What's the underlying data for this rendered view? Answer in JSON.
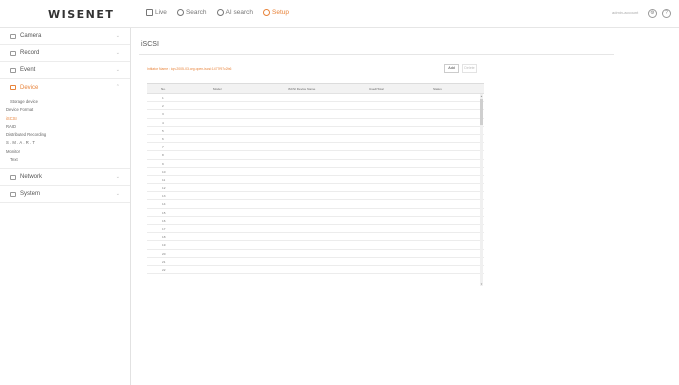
{
  "app": {
    "logo": "WISENET"
  },
  "top_nav": [
    {
      "label": "Live",
      "icon": "monitor-icon",
      "active": false
    },
    {
      "label": "Search",
      "icon": "search-icon",
      "active": false
    },
    {
      "label": "AI search",
      "icon": "ai-search-icon",
      "active": false
    },
    {
      "label": "Setup",
      "icon": "gear-icon",
      "active": true
    }
  ],
  "user": {
    "name": "admin-account"
  },
  "sidebar": {
    "menus": [
      {
        "label": "Camera",
        "icon": "camera-icon"
      },
      {
        "label": "Record",
        "icon": "record-icon"
      },
      {
        "label": "Event",
        "icon": "bell-icon"
      },
      {
        "label": "Device",
        "icon": "device-icon",
        "active": true
      },
      {
        "label": "Network",
        "icon": "network-icon"
      },
      {
        "label": "System",
        "icon": "system-icon"
      }
    ],
    "device_items": [
      {
        "label": "Storage device",
        "indent": true
      },
      {
        "label": "Device Format"
      },
      {
        "label": "iSCSI",
        "active": true
      },
      {
        "label": "RAID"
      },
      {
        "label": "Distributed Recording"
      },
      {
        "label": "S.M.A.R.T",
        "spaced": true
      },
      {
        "label": "Monitor"
      },
      {
        "label": "Text",
        "indent": true
      }
    ]
  },
  "main": {
    "title": "iSCSI",
    "info": "Initiator Name : iqn.2005-03.org.open-iscsi:1477f97c2b6",
    "add_label": "Add",
    "delete_label": "Delete",
    "columns": [
      "No.",
      "Model",
      "iSCSI Device Name",
      "Used/Total",
      "Status"
    ],
    "rows": [
      "1",
      "2",
      "3",
      "4",
      "5",
      "6",
      "7",
      "8",
      "9",
      "10",
      "11",
      "12",
      "13",
      "14",
      "15",
      "16",
      "17",
      "18",
      "19",
      "20",
      "21",
      "22"
    ]
  },
  "colors": {
    "accent": "#e8833a"
  }
}
